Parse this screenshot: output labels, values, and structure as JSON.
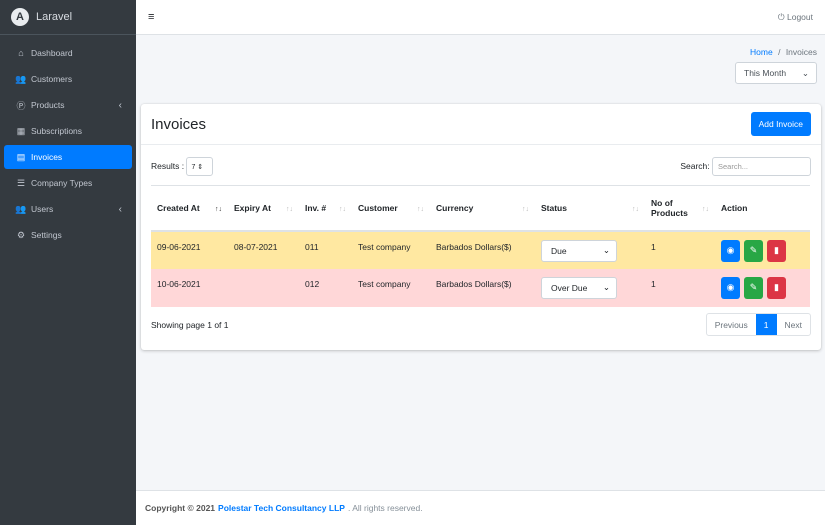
{
  "sidebar": {
    "brand": "Laravel",
    "logo": "A",
    "items": [
      {
        "label": "Dashboard",
        "icon": "home-icon"
      },
      {
        "label": "Customers",
        "icon": "users-icon"
      },
      {
        "label": "Products",
        "icon": "product-icon"
      },
      {
        "label": "Subscriptions",
        "icon": "calendar-icon"
      },
      {
        "label": "Invoices",
        "icon": "file-icon"
      },
      {
        "label": "Company Types",
        "icon": "list-icon"
      },
      {
        "label": "Users",
        "icon": "users-cog-icon"
      },
      {
        "label": "Settings",
        "icon": "cogs-icon"
      }
    ]
  },
  "header": {
    "menu": "≡",
    "logout": "Logout"
  },
  "breadcrumb": {
    "home": "Home",
    "sep": "/",
    "current": "Invoices"
  },
  "period": "This Month",
  "card": {
    "title": "Invoices",
    "add": "Add Invoice",
    "results_label": "Results :",
    "results_value": "7",
    "search_label": "Search:",
    "search_placeholder": "Search...",
    "columns": [
      "Created At",
      "Expiry At",
      "Inv. #",
      "Customer",
      "Currency",
      "Status",
      "No of Products",
      "Action"
    ],
    "rows": [
      {
        "created": "09-06-2021",
        "expiry": "08-07-2021",
        "inv": "011",
        "customer": "Test company",
        "currency": "Barbados Dollars($)",
        "status": "Due",
        "products": "1"
      },
      {
        "created": "10-06-2021",
        "expiry": "",
        "inv": "012",
        "customer": "Test company",
        "currency": "Barbados Dollars($)",
        "status": "Over Due",
        "products": "1"
      }
    ],
    "showing": "Showing page 1 of 1",
    "pager": {
      "prev": "Previous",
      "page": "1",
      "next": "Next"
    }
  },
  "footer": {
    "prefix": "Copyright © 2021",
    "company": "Polestar Tech Consultancy LLP",
    "suffix": ". All rights reserved."
  },
  "colors": {
    "sidebar": "#343a40",
    "accent": "#007bff",
    "due": "#ffe8a1",
    "overdue": "#ffd7d8",
    "view": "#007bff",
    "edit": "#28a745",
    "delete": "#dc3545"
  }
}
